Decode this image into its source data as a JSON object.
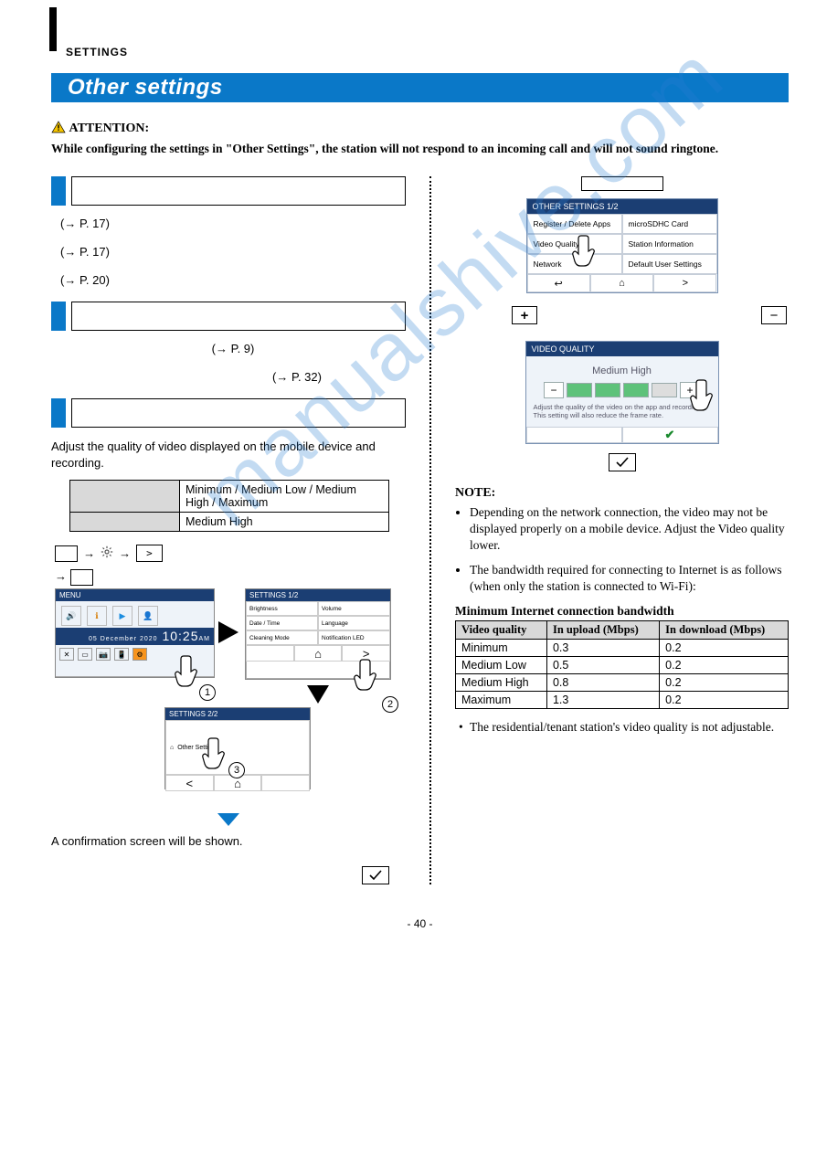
{
  "section_tag": "SETTINGS",
  "heading": "Other settings",
  "attention_label": "ATTENTION:",
  "attention_text": "While configuring the settings in \"Other Settings\", the station will not respond to an incoming call and will not sound ringtone.",
  "left": {
    "ref1": "(→ P. 17)",
    "ref2": "(→ P. 17)",
    "ref3": "(→ P. 20)",
    "ref4": "(→ P. 9)",
    "ref5": "(→ P. 32)",
    "vq_intro": "Adjust the quality of video displayed on the mobile device and recording.",
    "vq_settings_value": "Minimum / Medium Low / Medium High / Maximum",
    "vq_default_value": "Medium High",
    "step_arrow": "→",
    "confirmation_text": "A conﬁrmation screen will be shown."
  },
  "menu_mini": {
    "title": "MENU",
    "clock_date": "05 December 2020",
    "clock_time": "10:25",
    "clock_ampm": "AM"
  },
  "settings1_mini": {
    "title": "SETTINGS 1/2",
    "rows": [
      [
        "Brightness",
        "Volume"
      ],
      [
        "Date / Time",
        "Language"
      ],
      [
        "Cleaning Mode",
        "Notification LED"
      ]
    ]
  },
  "settings2_mini": {
    "title": "SETTINGS 2/2",
    "item": "Other Settings"
  },
  "right_other_settings": {
    "title": "OTHER SETTINGS 1/2",
    "items": [
      [
        "Register / Delete Apps",
        "microSDHC Card"
      ],
      [
        "Video Quality",
        "Station Information"
      ],
      [
        "Network",
        "Default User Settings"
      ]
    ]
  },
  "plus_label": "+",
  "minus_label": "−",
  "vq_panel": {
    "title": "VIDEO QUALITY",
    "current": "Medium High",
    "desc": "Adjust the quality of the video on the app and recording. This setting will also reduce the frame rate."
  },
  "note_title": "NOTE:",
  "notes": [
    "Depending on the network connection, the video may not be displayed properly on a mobile device. Adjust the Video quality lower.",
    "The bandwidth required for connecting to Internet is as follows (when only the station is connected to Wi-Fi):"
  ],
  "bw_title": "Minimum Internet connection bandwidth",
  "bw_headers": [
    "Video quality",
    "In upload (Mbps)",
    "In download (Mbps)"
  ],
  "bw_rows": [
    [
      "Minimum",
      "0.3",
      "0.2"
    ],
    [
      "Medium Low",
      "0.5",
      "0.2"
    ],
    [
      "Medium High",
      "0.8",
      "0.2"
    ],
    [
      "Maximum",
      "1.3",
      "0.2"
    ]
  ],
  "note_final": "The residential/tenant station's video quality is not adjustable.",
  "watermark": "manualshive.com",
  "page_number": "- 40 -"
}
